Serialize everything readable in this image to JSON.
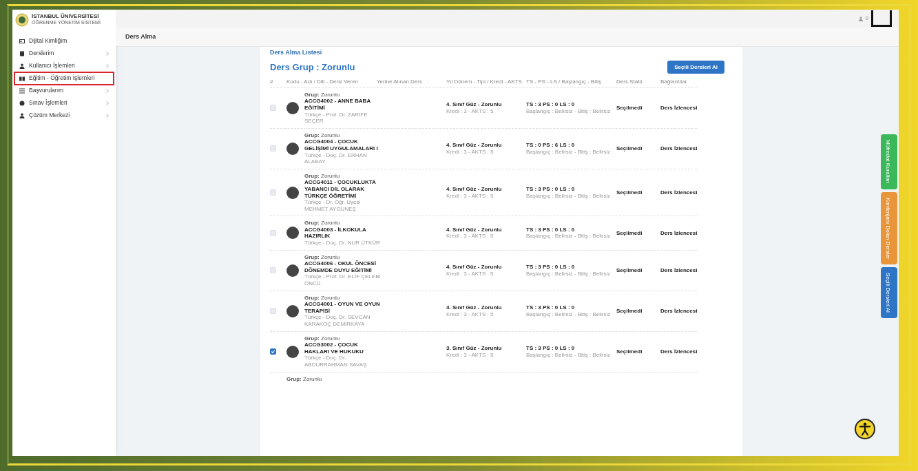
{
  "logo": {
    "title": "İSTANBUL ÜNİVERSİTESİ",
    "subtitle": "ÖĞRENME YÖNETİM SİSTEMİ"
  },
  "sidebar": {
    "items": [
      {
        "label": "Dijital Kimliğim",
        "has_submenu": false,
        "highlighted": false
      },
      {
        "label": "Derslerim",
        "has_submenu": true,
        "highlighted": false
      },
      {
        "label": "Kullanıcı İşlemleri",
        "has_submenu": true,
        "highlighted": false
      },
      {
        "label": "Eğitim - Öğretim İşlemleri",
        "has_submenu": false,
        "highlighted": true
      },
      {
        "label": "Başvurularım",
        "has_submenu": true,
        "highlighted": false
      },
      {
        "label": "Sınav İşlemleri",
        "has_submenu": true,
        "highlighted": false
      },
      {
        "label": "Çözüm Merkezi",
        "has_submenu": true,
        "highlighted": false
      }
    ]
  },
  "topbar": {
    "notification_count": "0"
  },
  "page_title": "Ders Alma",
  "card": {
    "breadcrumb": "Ders Alma Listesi",
    "title": "Ders Grup : Zorunlu",
    "action_button": "Seçili Dersleri Al",
    "table": {
      "columns": [
        "#",
        "Kodu - Adı / Dili - Dersi Veren",
        "Yerine Alınan Ders",
        "Yıl Dönem - Tipi / Kredi - AKTS",
        "TS - PS - LS / Başlangıç - Bitiş",
        "Ders Statü",
        "Bağlantılar"
      ],
      "rows": [
        {
          "checked": false,
          "group": "**Grup:** Zorunlu",
          "course": "ACCG4002 - ANNE BABA EĞİTİMİ",
          "instructor": "Türkçe - Prof. Dr. ZARİFE SEÇER",
          "term": "4. Sınıf Güz - Zorunlu",
          "credits": "Kredi : 3 - AKTS : 5",
          "hours": "TS : 3 PS : 0 LS : 0",
          "dates": "Başlangıç : Belirsiz - Bitiş : Belirsiz",
          "status": "Seçilmedi",
          "link": "Ders İzlencesi"
        },
        {
          "checked": false,
          "group": "**Grup:** Zorunlu",
          "course": "ACCG4004 - ÇOCUK GELİŞİMİ UYGULAMALARI I",
          "instructor": "Türkçe - Doç. Dr. ERHAN ALABAY",
          "term": "4. Sınıf Güz - Zorunlu",
          "credits": "Kredi : 3 - AKTS : 5",
          "hours": "TS : 0 PS : 6 LS : 0",
          "dates": "Başlangıç : Belirsiz - Bitiş : Belirsiz",
          "status": "Seçilmedi",
          "link": "Ders İzlencesi"
        },
        {
          "checked": false,
          "group": "**Grup:** Zorunlu",
          "course": "ACCG4011 - ÇOCUKLUKTA YABANCI DİL OLARAK TÜRKÇE ÖĞRETİMİ",
          "instructor": "Türkçe - Dr. Öğr. Üyesi MEHMET AYGÜNEŞ",
          "term": "4. Sınıf Güz - Zorunlu",
          "credits": "Kredi : 3 - AKTS : 5",
          "hours": "TS : 3 PS : 0 LS : 0",
          "dates": "Başlangıç : Belirsiz - Bitiş : Belirsiz",
          "status": "Seçilmedi",
          "link": "Ders İzlencesi"
        },
        {
          "checked": false,
          "group": "**Grup:** Zorunlu",
          "course": "ACCG4003 - İLKOKULA HAZIRLIK",
          "instructor": "Türkçe - Doç. Dr. NUR ÜTKÜR",
          "term": "4. Sınıf Güz - Zorunlu",
          "credits": "Kredi : 3 - AKTS : 5",
          "hours": "TS : 3 PS : 0 LS : 0",
          "dates": "Başlangıç : Belirsiz - Bitiş : Belirsiz",
          "status": "Seçilmedi",
          "link": "Ders İzlencesi"
        },
        {
          "checked": false,
          "group": "**Grup:** Zorunlu",
          "course": "ACCG4006 - OKUL ÖNCESİ DÖNEMDE DUYU EĞİTİMİ",
          "instructor": "Türkçe - Prof. Dr. ELİF ÇELEBİ ÖNCÜ",
          "term": "4. Sınıf Güz - Zorunlu",
          "credits": "Kredi : 3 - AKTS : 5",
          "hours": "TS : 3 PS : 0 LS : 0",
          "dates": "Başlangıç : Belirsiz - Bitiş : Belirsiz",
          "status": "Seçilmedi",
          "link": "Ders İzlencesi"
        },
        {
          "checked": false,
          "group": "**Grup:** Zorunlu",
          "course": "ACCG4001 - OYUN VE OYUN TERAPİSİ",
          "instructor": "Türkçe - Doç. Dr. SEVCAN KARAKOÇ DEMİRKAYA",
          "term": "4. Sınıf Güz - Zorunlu",
          "credits": "Kredi : 3 - AKTS : 5",
          "hours": "TS : 3 PS : 0 LS : 0",
          "dates": "Başlangıç : Belirsiz - Bitiş : Belirsiz",
          "status": "Seçilmedi",
          "link": "Ders İzlencesi"
        },
        {
          "checked": true,
          "group": "**Grup:** Zorunlu",
          "course": "ACCG3002 - ÇOCUK HAKLARI VE HUKUKU",
          "instructor": "Türkçe - Doç. Dr. ABDURRAHMAN SAVAŞ",
          "term": "3. Sınıf Güz - Zorunlu",
          "credits": "Kredi : 3 - AKTS : 5",
          "hours": "TS : 3 PS : 0 LS : 0",
          "dates": "Başlangıç : Belirsiz - Bitiş : Belirsiz",
          "status": "Seçilmedi",
          "link": "Ders İzlencesi"
        },
        {
          "group": "**Grup:** Zorunlu"
        }
      ]
    }
  },
  "side_tabs": [
    {
      "label": "Müfredat Kuralları",
      "color": "#3bb85a"
    },
    {
      "label": "Kontenjanı Dolan Dersler",
      "color": "#e9953a"
    },
    {
      "label": "Seçili Dersleri Al",
      "color": "#2f75c6"
    }
  ]
}
